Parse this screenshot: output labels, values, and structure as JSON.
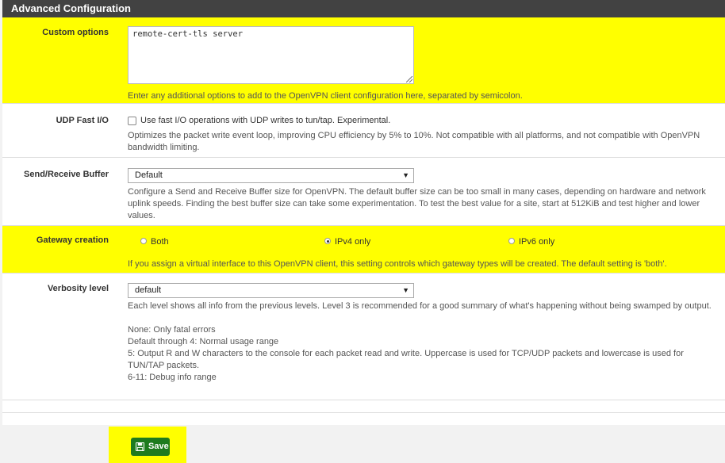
{
  "panel": {
    "title": "Advanced Configuration"
  },
  "custom_options": {
    "label": "Custom options",
    "value": "remote-cert-tls server",
    "help": "Enter any additional options to add to the OpenVPN client configuration here, separated by semicolon."
  },
  "udp_fast_io": {
    "label": "UDP Fast I/O",
    "checkbox_label": "Use fast I/O operations with UDP writes to tun/tap. Experimental.",
    "checked": false,
    "help": "Optimizes the packet write event loop, improving CPU efficiency by 5% to 10%. Not compatible with all platforms, and not compatible with OpenVPN bandwidth limiting."
  },
  "send_receive_buffer": {
    "label": "Send/Receive Buffer",
    "selected": "Default",
    "help": "Configure a Send and Receive Buffer size for OpenVPN. The default buffer size can be too small in many cases, depending on hardware and network uplink speeds. Finding the best buffer size can take some experimentation. To test the best value for a site, start at 512KiB and test higher and lower values."
  },
  "gateway_creation": {
    "label": "Gateway creation",
    "options": [
      "Both",
      "IPv4 only",
      "IPv6 only"
    ],
    "selected": "IPv4 only",
    "help": "If you assign a virtual interface to this OpenVPN client, this setting controls which gateway types will be created. The default setting is 'both'."
  },
  "verbosity": {
    "label": "Verbosity level",
    "selected": "default",
    "help_lines": [
      "Each level shows all info from the previous levels. Level 3 is recommended for a good summary of what's happening without being swamped by output.",
      "",
      "None: Only fatal errors",
      "Default through 4: Normal usage range",
      "5: Output R and W characters to the console for each packet read and write. Uppercase is used for TCP/UDP packets and lowercase is used for TUN/TAP packets.",
      "6-11: Debug info range"
    ]
  },
  "save_button": {
    "label": "Save"
  },
  "colors": {
    "highlight": "#ffff00",
    "header": "#424242",
    "save": "#1e7b1e"
  }
}
